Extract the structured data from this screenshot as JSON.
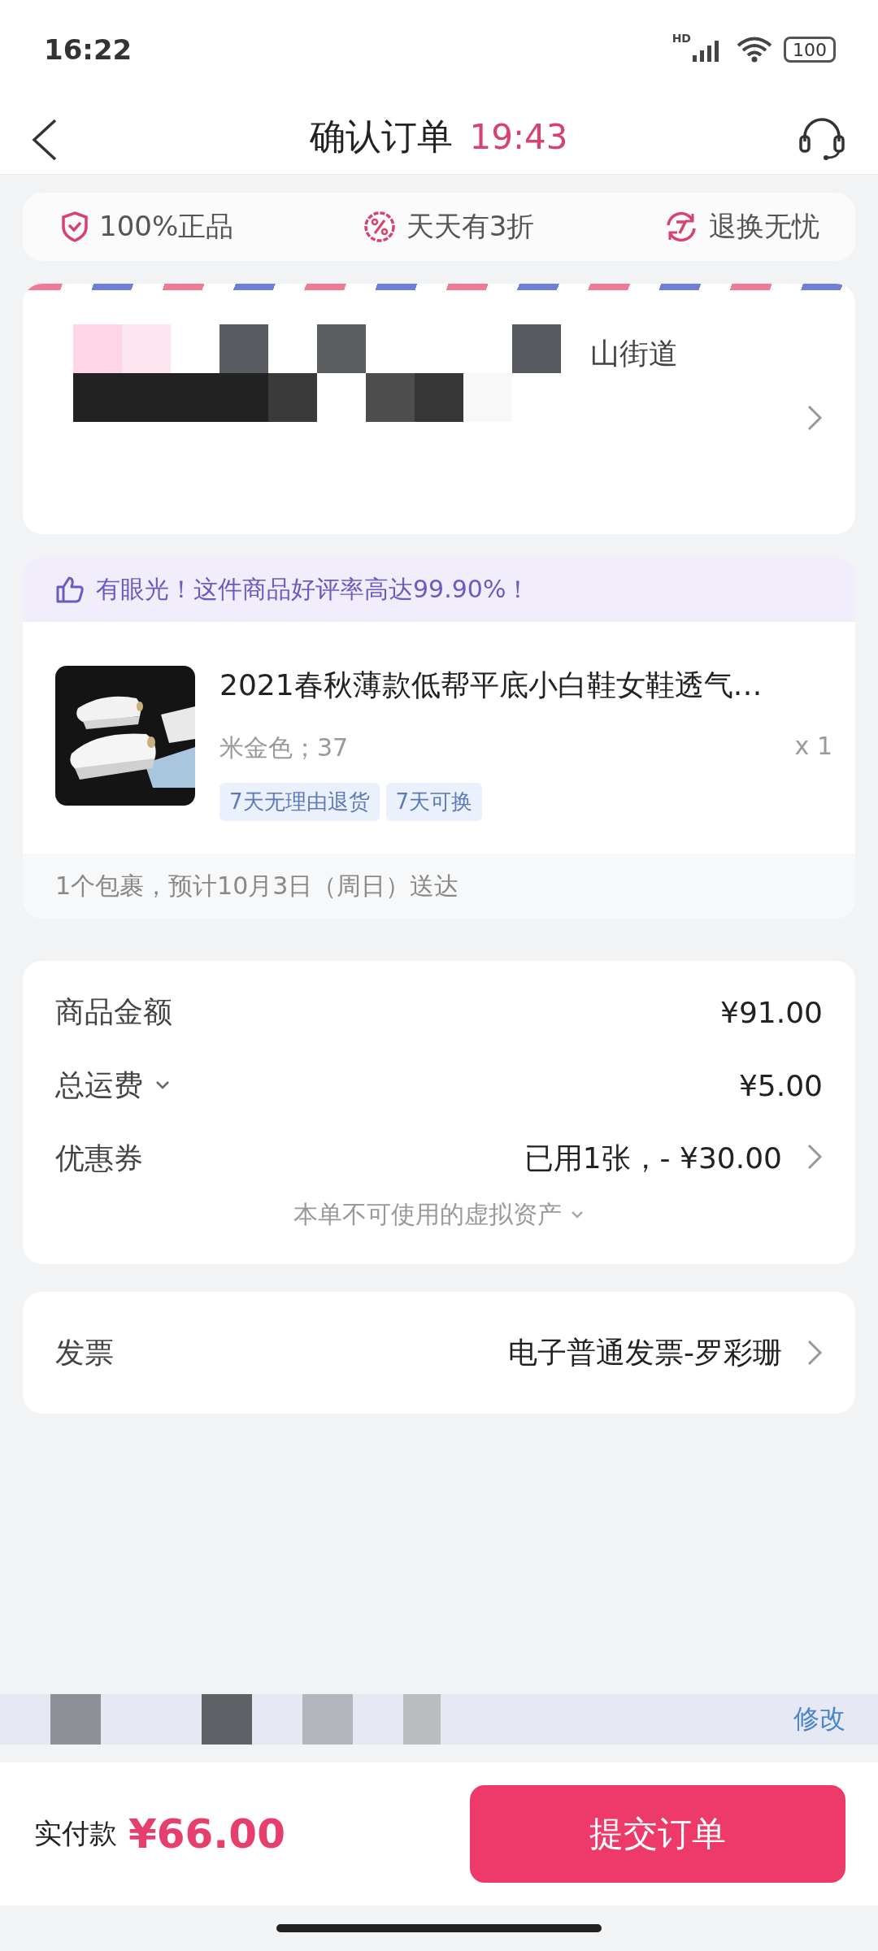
{
  "status_bar": {
    "time": "16:22",
    "network": "HD",
    "battery": "100"
  },
  "header": {
    "title": "确认订单",
    "countdown": "19:43"
  },
  "guarantees": [
    {
      "label": "100%正品",
      "kind": "shield"
    },
    {
      "label": "天天有3折",
      "kind": "discount"
    },
    {
      "label": "退换无忧",
      "kind": "exchange"
    }
  ],
  "address": {
    "visible_text": "山街道"
  },
  "order": {
    "praise": "有眼光！这件商品好评率高达99.90%！",
    "product": {
      "kind": "picture",
      "title": "2021春秋薄款低帮平底小白鞋女鞋透气…",
      "spec": "米金色；37",
      "quantity": "x 1",
      "tags": [
        "7天无理由退货",
        "7天可换"
      ]
    },
    "delivery": "1个包裹，预计10月3日（周日）送达"
  },
  "fees": {
    "rows": [
      {
        "label": "商品金额",
        "value": "¥91.00",
        "kind": "plain"
      },
      {
        "label": "总运费",
        "value": "¥5.00",
        "kind": "expand"
      },
      {
        "label": "优惠券",
        "value": "已用1张，- ¥30.00",
        "kind": "link"
      }
    ],
    "more": "本单不可使用的虚拟资产"
  },
  "invoice": {
    "label": "发票",
    "value": "电子普通发票-罗彩珊"
  },
  "footer": {
    "edit": "修改",
    "total_label": "实付款",
    "total": "¥66.00",
    "submit": "提交订单"
  }
}
